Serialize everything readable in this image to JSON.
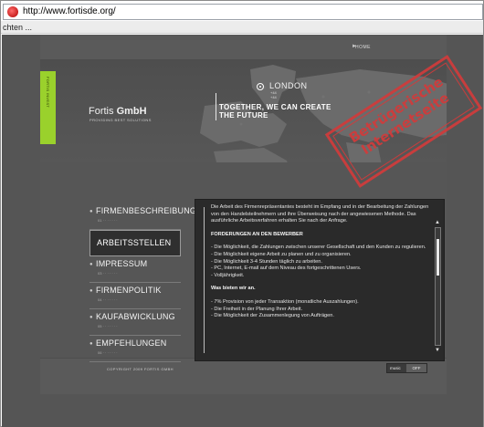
{
  "browser": {
    "url": "http://www.fortisde.org/",
    "status_text": "chten ..."
  },
  "site": {
    "top_link": "HOME",
    "vertical_label": "FORTIS INVEST",
    "logo_name": "Fortis",
    "logo_suffix": "GmbH",
    "logo_sub": "PROVIDING BEST SOLUTIONS",
    "city": "LONDON",
    "city_sub1": "+44",
    "city_sub2": "+44",
    "tagline_1": "TOGETHER, WE CAN CREATE",
    "tagline_2": "THE FUTURE",
    "stamp_line1": "Betrügerische",
    "stamp_line2": "Internetseite",
    "colors": {
      "accent_green": "#9ad12c",
      "stamp_red": "#d23b3b",
      "background": "#555555"
    }
  },
  "nav": {
    "items": [
      {
        "label": "FIRMENBESCHREIBUNG",
        "active": false
      },
      {
        "label": "ARBEITSSTELLEN",
        "active": true
      },
      {
        "label": "IMPRESSUM",
        "active": false
      },
      {
        "label": "FIRMENPOLITIK",
        "active": false
      },
      {
        "label": "KAUFABWICKLUNG",
        "active": false
      },
      {
        "label": "EMPFEHLUNGEN",
        "active": false
      }
    ]
  },
  "content": {
    "intro": "Die Arbeit des Firmenrepräsentantes besteht im Empfang und in der Bearbeitung der Zahlungen von den Handelsteilnehmern und ihre Überweisung nach der angewiesenen Methode. Das ausführliche Arbeitsverfahren erhalten Sie nach der Anfrage.",
    "req_heading": "FORDERUNGEN AN DEN BEWERBER",
    "req_1": "- Die Möglichkeit, die Zahlungen zwischen unserer Gesellschaft und den Kunden zu regulieren.",
    "req_2": "- Die Möglichkeit eigene Arbeit zu planen und zu organisieren.",
    "req_3": "- Die Möglichkeit 3-4 Stunden täglich zu arbeiten.",
    "req_4": "- PC, Internet, E-mail auf dem Niveau des fortgeschrittenen Users.",
    "req_5": "- Volljährigkeit.",
    "offer_heading": "Was bieten wir an.",
    "offer_1": "- 7% Provision von jeder Transaktion (monatliche Auszahlungen).",
    "offer_2": "- Die Freiheit in der Planung Ihrer Arbeit.",
    "offer_3": "- Die Möglichkeit der Zusammenlegung von Aufträgen."
  },
  "footer": {
    "copyright": "COPYRIGHT 2009 FORTIS GMBH",
    "music_label": "music",
    "music_state": "OFF"
  }
}
